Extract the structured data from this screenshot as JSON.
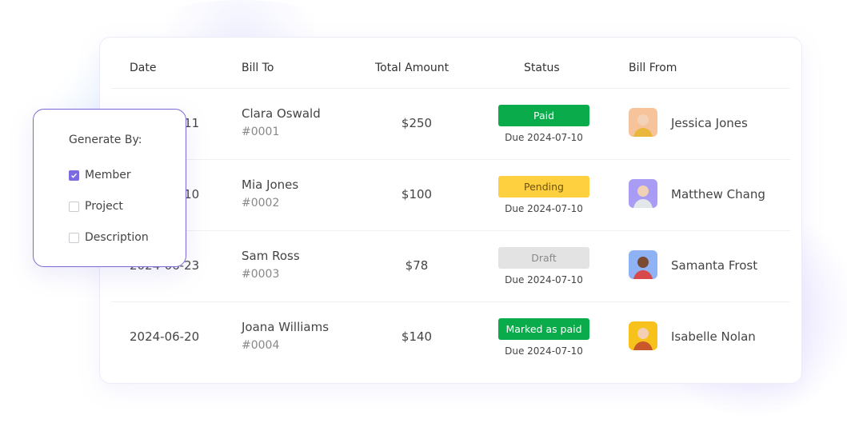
{
  "table": {
    "headers": {
      "date": "Date",
      "bill_to": "Bill To",
      "total_amount": "Total Amount",
      "status": "Status",
      "bill_from": "Bill From"
    },
    "rows": [
      {
        "date": "2024-07-11",
        "bill_to_name": "Clara Oswald",
        "bill_to_id": "#0001",
        "amount": "$250",
        "status": "Paid",
        "status_bg": "#0aab4b",
        "status_fg": "#ffffff",
        "due": "Due 2024-07-10",
        "from_name": "Jessica Jones",
        "avatar_bg": "#f6c39a",
        "avatar_fg": "#e9b73b"
      },
      {
        "date": "2024-07-10",
        "bill_to_name": "Mia Jones",
        "bill_to_id": "#0002",
        "amount": "$100",
        "status": "Pending",
        "status_bg": "#fecf3e",
        "status_fg": "#6b5310",
        "due": "Due 2024-07-10",
        "from_name": "Matthew Chang",
        "avatar_bg": "#a99cf5",
        "avatar_fg": "#e2e8ea"
      },
      {
        "date": "2024-06-23",
        "bill_to_name": "Sam Ross",
        "bill_to_id": "#0003",
        "amount": "$78",
        "status": "Draft",
        "status_bg": "#e3e3e3",
        "status_fg": "#8a8a8a",
        "due": "Due 2024-07-10",
        "from_name": "Samanta Frost",
        "avatar_bg": "#8fb2f5",
        "avatar_fg": "#d8494b"
      },
      {
        "date": "2024-06-20",
        "bill_to_name": "Joana Williams",
        "bill_to_id": "#0004",
        "amount": "$140",
        "status": "Marked as paid",
        "status_bg": "#0aab4b",
        "status_fg": "#ffffff",
        "due": "Due 2024-07-10",
        "from_name": "Isabelle Nolan",
        "avatar_bg": "#f7c21c",
        "avatar_fg": "#c9582a"
      }
    ]
  },
  "popover": {
    "title": "Generate By:",
    "options": [
      {
        "label": "Member",
        "checked": true
      },
      {
        "label": "Project",
        "checked": false
      },
      {
        "label": "Description",
        "checked": false
      }
    ],
    "accent": "#7b6ae0"
  }
}
